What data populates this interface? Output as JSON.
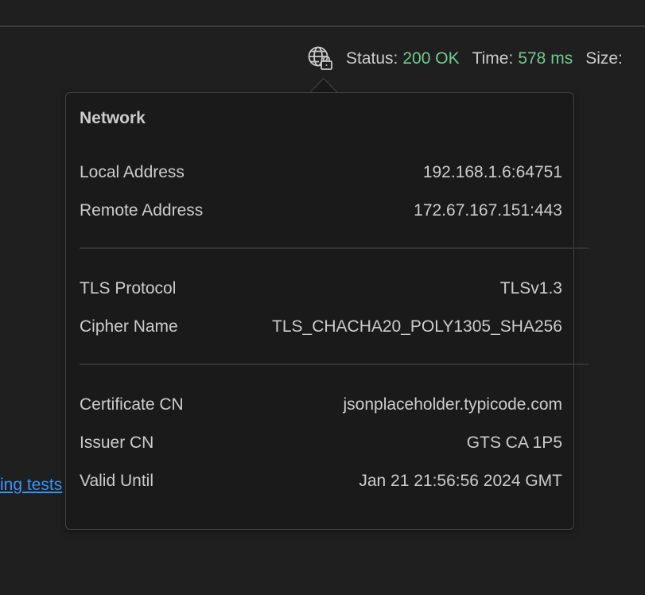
{
  "status_bar": {
    "network_icon": "globe-lock-icon",
    "status_label": "Status:",
    "status_value": "200 OK",
    "time_label": "Time:",
    "time_value": "578 ms",
    "size_label": "Size:",
    "ok_color": "#73c991"
  },
  "background_link": {
    "text": "ing tests"
  },
  "network_popover": {
    "title": "Network",
    "connection": [
      {
        "label": "Local Address",
        "value": "192.168.1.6:64751"
      },
      {
        "label": "Remote Address",
        "value": "172.67.167.151:443"
      }
    ],
    "tls": [
      {
        "label": "TLS Protocol",
        "value": "TLSv1.3"
      },
      {
        "label": "Cipher Name",
        "value": "TLS_CHACHA20_POLY1305_SHA256"
      }
    ],
    "certificate": [
      {
        "label": "Certificate CN",
        "value": "jsonplaceholder.typicode.com"
      },
      {
        "label": "Issuer CN",
        "value": "GTS CA 1P5"
      },
      {
        "label": "Valid Until",
        "value": "Jan 21 21:56:56 2024 GMT"
      }
    ]
  }
}
